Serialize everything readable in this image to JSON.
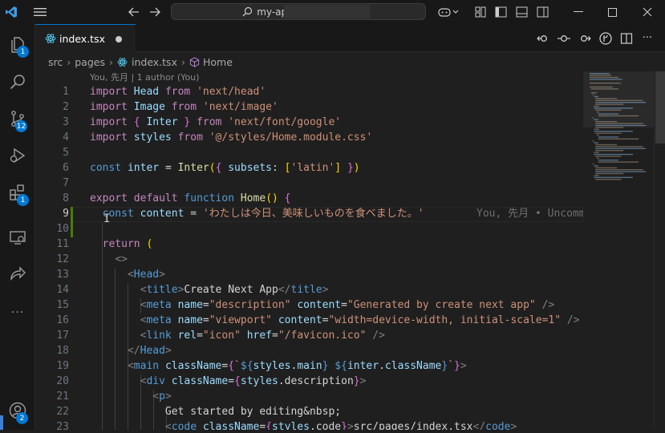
{
  "titlebar": {
    "search_text": "my-app"
  },
  "activity": {
    "explorer_badge": "1",
    "source_control_badge": "12",
    "extensions_badge": "1",
    "accounts_badge": "2",
    "more_label": "···"
  },
  "tab": {
    "label": "index.tsx"
  },
  "breadcrumb": {
    "items": [
      "src",
      "pages",
      "index.tsx",
      "Home"
    ]
  },
  "editor": {
    "blame_header": "You, 先月 | 1 author (You)",
    "active_line": 9,
    "inline_blame": "You, 先月 • Uncomm",
    "line_numbers": [
      "1",
      "2",
      "3",
      "4",
      "5",
      "6",
      "7",
      "8",
      "9",
      "10",
      "11",
      "12",
      "13",
      "14",
      "15",
      "16",
      "17",
      "18",
      "19",
      "20",
      "21",
      "22",
      "23"
    ],
    "lines": [
      "import Head from 'next/head'",
      "import Image from 'next/image'",
      "import { Inter } from 'next/font/google'",
      "import styles from '@/styles/Home.module.css'",
      "",
      "const inter = Inter({ subsets: ['latin'] })",
      "",
      "export default function Home() {",
      "  const content = 'わたしは今日、美味しいものを食べました。'",
      "",
      "  return (",
      "    <>",
      "      <Head>",
      "        <title>Create Next App</title>",
      "        <meta name=\"description\" content=\"Generated by create next app\" />",
      "        <meta name=\"viewport\" content=\"width=device-width, initial-scale=1\" />",
      "        <link rel=\"icon\" href=\"/favicon.ico\" />",
      "      </Head>",
      "      <main className={`${styles.main} ${inter.className}`}>",
      "        <div className={styles.description}>",
      "          <p>",
      "            Get started by editing&nbsp;",
      "            <code className={styles.code}>src/pages/index.tsx</code>"
    ]
  },
  "colors": {
    "accent": "#0078d4",
    "keyword": "#569cd6",
    "control_keyword": "#c586c0",
    "string": "#ce9178",
    "variable": "#9cdcfe",
    "function": "#dcdcaa",
    "modified_gutter": "#487e02"
  }
}
